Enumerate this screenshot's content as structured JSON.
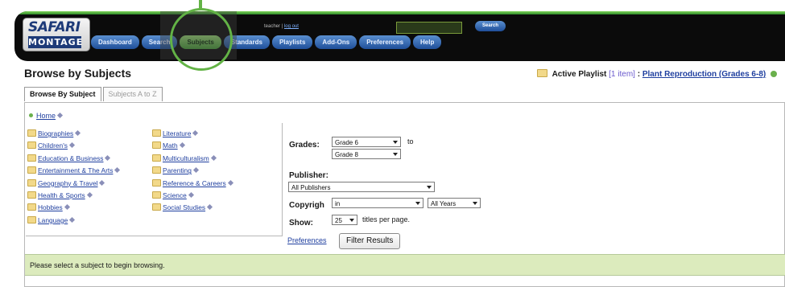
{
  "app": {
    "logo_line1": "SAFARI",
    "logo_line2": "MONTAGE"
  },
  "header": {
    "user_label": "teacher",
    "separator": "|",
    "logout_label": "log out",
    "search_button": "Search",
    "nav": [
      {
        "label": "Dashboard",
        "active": false
      },
      {
        "label": "Search",
        "active": false
      },
      {
        "label": "Subjects",
        "active": true
      },
      {
        "label": "Standards",
        "active": false
      },
      {
        "label": "Playlists",
        "active": false
      },
      {
        "label": "Add-Ons",
        "active": false
      },
      {
        "label": "Preferences",
        "active": false
      },
      {
        "label": "Help",
        "active": false
      }
    ]
  },
  "page": {
    "title": "Browse by Subjects",
    "active_playlist_label": "Active Playlist",
    "active_playlist_count": "[1 item]",
    "active_playlist_sep": ":",
    "active_playlist_name": "Plant Reproduction (Grades 6-8)"
  },
  "tabs": [
    {
      "label": "Browse By Subject",
      "active": true
    },
    {
      "label": "Subjects A to Z",
      "active": false
    }
  ],
  "subjects": {
    "home_label": "Home",
    "col1": [
      "Biographies",
      "Children's",
      "Education & Business",
      "Entertainment & The Arts",
      "Geography & Travel",
      "Health & Sports",
      "Hobbies",
      "Language"
    ],
    "col2": [
      "Literature",
      "Math",
      "Multiculturalism",
      "Parenting",
      "Reference & Careers",
      "Science",
      "Social Studies"
    ]
  },
  "filters": {
    "grades_label": "Grades:",
    "grade_from": "Grade 6",
    "grade_to_word": "to",
    "grade_to": "Grade 8",
    "publisher_label": "Publisher:",
    "publisher_value": "All Publishers",
    "copyright_label": "Copyrigh",
    "copyright_mode": "in",
    "copyright_years": "All Years",
    "show_label": "Show:",
    "show_value": "25",
    "show_suffix": "titles per page.",
    "preferences_link": "Preferences",
    "filter_button": "Filter Results"
  },
  "status": {
    "message": "Please select a subject to begin browsing."
  }
}
